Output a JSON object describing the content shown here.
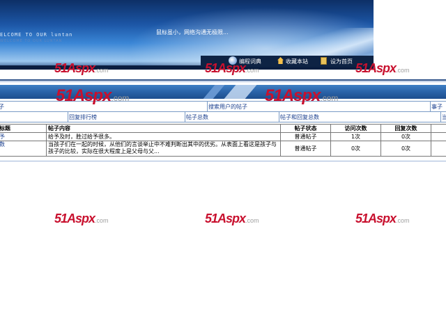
{
  "banner": {
    "welcome_text": "ELCOME TO OUR luntan",
    "welcome_sub": "WELCOME TO OUR LUNTAN",
    "slogan": "鼠标虽小，网络沟通无极限...",
    "nav": [
      "编程词典",
      "收藏本站",
      "设为首页"
    ]
  },
  "links_row1": [
    "子",
    "搜索用户的帖子",
    "事子"
  ],
  "links_row2": [
    "回复排行榜",
    "帖子总数",
    "帖子和回复总数",
    "当"
  ],
  "table": {
    "headers": [
      "标题",
      "帖子内容",
      "帖子状态",
      "访问次数",
      "回复次数"
    ],
    "rows": [
      {
        "title": "予",
        "content": "给予及时，胜过给予很多。",
        "status": "普通帖子",
        "visits": "1次",
        "replies": "0次"
      },
      {
        "title": "数",
        "content": "当孩子们在一起的时候，从他们的言谈举止中不难判断出其中的优劣。从表面上看这是孩子与孩子的比较，实际在很大程度上是父母与父...",
        "status": "普通帖子",
        "visits": "0次",
        "replies": "0次"
      }
    ]
  },
  "watermark": {
    "brand": "51Aspx",
    "suffix": ".com"
  }
}
